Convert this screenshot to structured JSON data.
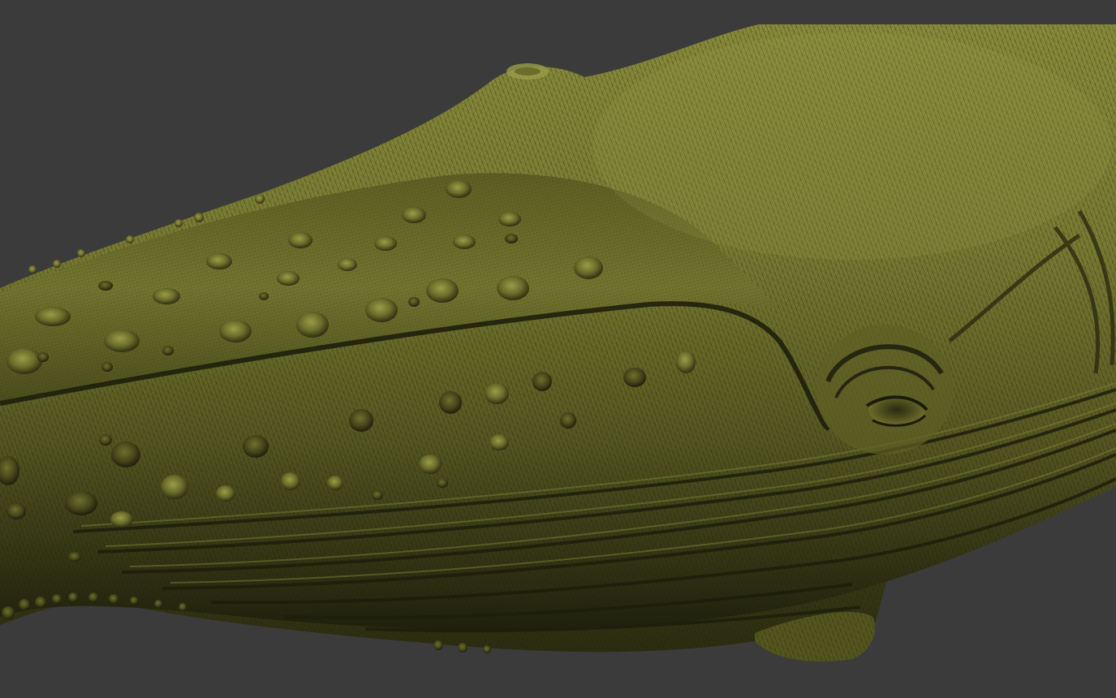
{
  "viewport": {
    "background_color": "#3b3b3b",
    "model": {
      "name": "humpback-whale-head",
      "display_mode": "wireframe-shaded",
      "base_color": "#6b6d2a",
      "highlight_color": "#8a8c3c",
      "shadow_color": "#252610",
      "wire_color": "#1a1a0a"
    }
  }
}
